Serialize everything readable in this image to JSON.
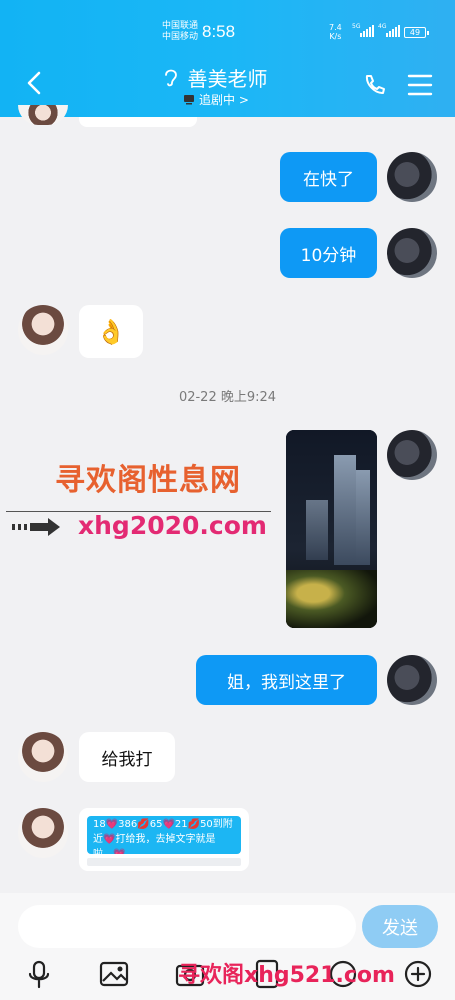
{
  "status_bar": {
    "carrier_1": "中国联通",
    "carrier_2": "中国移动",
    "time": "8:58",
    "net_speed_value": "7.4",
    "net_speed_unit": "K/s",
    "signal_1_tag": "5G",
    "signal_2_tag": "4G",
    "battery": "49"
  },
  "header": {
    "title": "善美老师",
    "subtitle": "追剧中 >",
    "icons": [
      "back-arrow-icon",
      "ear-icon",
      "tv-icon",
      "phone-icon",
      "menu-icon"
    ]
  },
  "messages": [
    {
      "side": "right",
      "type": "text",
      "text": "在快了"
    },
    {
      "side": "right",
      "type": "text",
      "text": "10分钟"
    },
    {
      "side": "left",
      "type": "emoji",
      "text": "👌"
    },
    {
      "type": "timestamp",
      "text": "02-22 晚上9:24"
    },
    {
      "side": "right",
      "type": "video"
    },
    {
      "side": "right",
      "type": "text",
      "text": "姐，我到这里了"
    },
    {
      "side": "left",
      "type": "text",
      "text": "给我打"
    },
    {
      "side": "left",
      "type": "card",
      "text": "18💗386💋65💗21💋50到附近💗打给我，去掉文字就是啦…💗"
    }
  ],
  "watermark": {
    "title": "寻欢阁性息网",
    "url": "xhg2020.com",
    "bottom": "寻欢阁xhg521.com"
  },
  "input_bar": {
    "placeholder": "",
    "send_label": "发送",
    "tools": [
      "microphone-icon",
      "image-icon",
      "camera-icon",
      "red-packet-icon",
      "emoji-icon",
      "plus-icon"
    ]
  },
  "colors": {
    "header_start": "#12b3f4",
    "bubble_out": "#0e99f5",
    "send_button": "#8fccf4",
    "watermark_red": "#e7612f",
    "watermark_pink": "#e32a73"
  }
}
